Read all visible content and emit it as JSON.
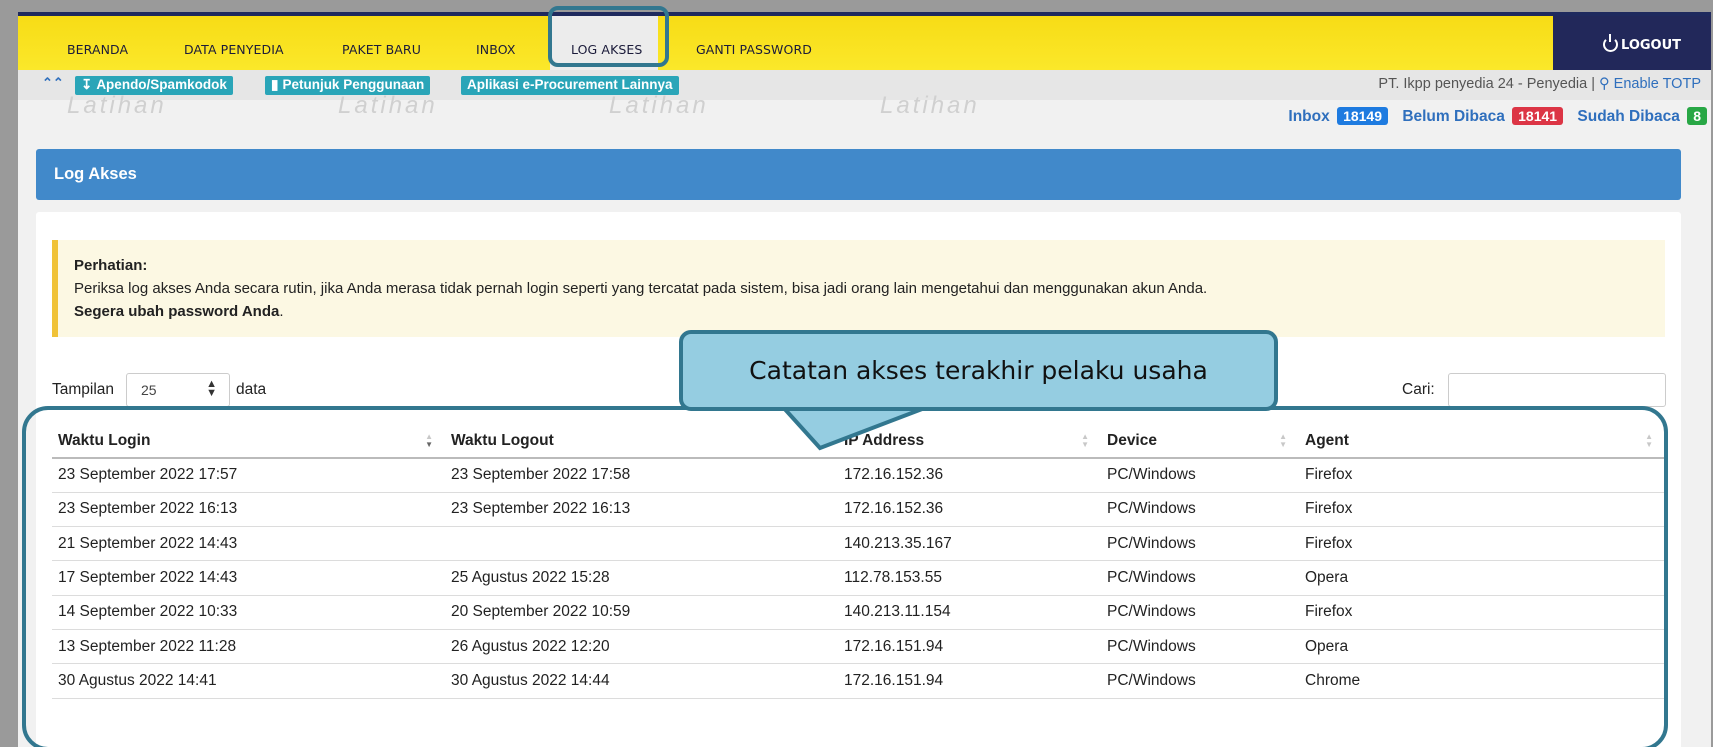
{
  "nav": {
    "items": [
      "BERANDA",
      "DATA PENYEDIA",
      "PAKET BARU",
      "INBOX",
      "LOG AKSES",
      "GANTI PASSWORD"
    ],
    "active": "LOG AKSES",
    "logout_label": "LOGOUT"
  },
  "subbar": {
    "links": [
      "Apendo/Spamkodok",
      "Petunjuk Penggunaan",
      "Aplikasi e-Procurement Lainnya"
    ],
    "user": "PT. Ikpp penyedia 24 - Penyedia |",
    "totp": "Enable TOTP"
  },
  "watermark": "Latihan",
  "counters": {
    "inbox_label": "Inbox",
    "inbox": "18149",
    "unread_label": "Belum Dibaca",
    "unread": "18141",
    "read_label": "Sudah Dibaca",
    "read": "8"
  },
  "panel": {
    "title": "Log Akses"
  },
  "alert": {
    "title": "Perhatian:",
    "body": "Periksa log akses Anda secara rutin, jika Anda merasa tidak pernah login seperti yang tercatat pada sistem, bisa jadi orang lain mengetahui dan menggunakan akun Anda.",
    "strong": "Segera ubah password Anda",
    "tail": "."
  },
  "controls": {
    "length_prefix": "Tampilan",
    "length_value": "25",
    "length_suffix": "data",
    "search_label": "Cari:"
  },
  "table": {
    "columns": [
      "Waktu Login",
      "Waktu Logout",
      "IP Address",
      "Device",
      "Agent"
    ],
    "rows": [
      [
        "23 September 2022 17:57",
        "23 September 2022 17:58",
        "172.16.152.36",
        "PC/Windows",
        "Firefox"
      ],
      [
        "23 September 2022 16:13",
        "23 September 2022 16:13",
        "172.16.152.36",
        "PC/Windows",
        "Firefox"
      ],
      [
        "21 September 2022 14:43",
        "",
        "140.213.35.167",
        "PC/Windows",
        "Firefox"
      ],
      [
        "17 September 2022 14:43",
        "25 Agustus 2022 15:28",
        "112.78.153.55",
        "PC/Windows",
        "Opera"
      ],
      [
        "14 September 2022 10:33",
        "20 September 2022 10:59",
        "140.213.11.154",
        "PC/Windows",
        "Firefox"
      ],
      [
        "13 September 2022 11:28",
        "26 Agustus 2022 12:20",
        "172.16.151.94",
        "PC/Windows",
        "Opera"
      ],
      [
        "30 Agustus 2022 14:41",
        "30 Agustus 2022 14:44",
        "172.16.151.94",
        "PC/Windows",
        "Chrome"
      ]
    ]
  },
  "callout": {
    "text": "Catatan akses terakhir pelaku usaha"
  }
}
